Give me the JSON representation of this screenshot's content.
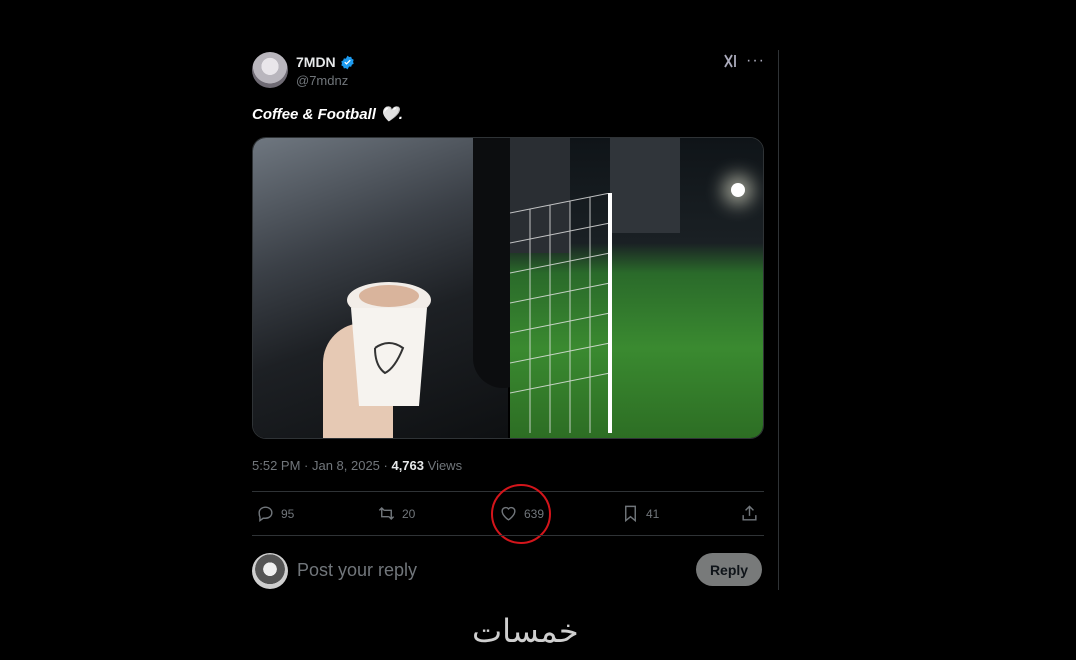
{
  "tweet": {
    "display_name": "7MDN",
    "handle": "@7mdnz",
    "text": "Coffee & Football 🤍.",
    "timestamp": "5:52 PM · Jan 8, 2025 · ",
    "views_count": "4,763",
    "views_label": " Views",
    "images": [
      "coffee-cup-in-car-photo",
      "football-goal-night-photo"
    ]
  },
  "actions": {
    "replies": "95",
    "retweets": "20",
    "likes": "639",
    "bookmarks": "41"
  },
  "composer": {
    "placeholder": "Post your reply",
    "reply_label": "Reply"
  },
  "watermark": "خمسات",
  "colors": {
    "background": "#000000",
    "verified": "#1d9bf0",
    "highlight": "#d4151b",
    "muted": "#71767b"
  }
}
